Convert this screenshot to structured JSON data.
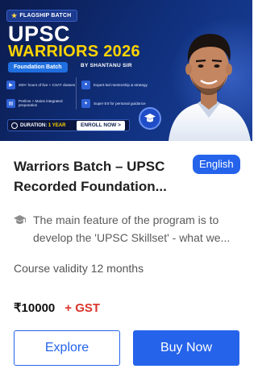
{
  "banner": {
    "tag": "FLAGSHIP BATCH",
    "title_line1": "UPSC",
    "title_line2": "WARRIORS 2026",
    "foundation_label": "Foundation Batch",
    "by_line": "BY SHANTANU SIR",
    "features": [
      "200+ hours of live + CSAT classes",
      "Expert-led mentorship & strategy",
      "Prelims + Mains integrated preparation",
      "Super EII for personal guidance"
    ],
    "duration_prefix": "DURATION:",
    "duration_value": "1 YEAR",
    "enroll_label": "ENROLL NOW >"
  },
  "course": {
    "title": "Warriors Batch – UPSC Recorded Foundation...",
    "language": "English",
    "description": "The main feature of the program is to develop the 'UPSC Skillset' - what we...",
    "validity": "Course validity 12 months",
    "price": "₹10000",
    "gst": "+ GST"
  },
  "actions": {
    "explore": "Explore",
    "buy_now": "Buy Now"
  },
  "colors": {
    "primary": "#2563eb",
    "gst_red": "#d9342b",
    "banner_navy": "#0b1b4d",
    "banner_yellow": "#ffd400"
  },
  "icons": {
    "description": "graduation-cap-icon",
    "banner_badge": "graduation-cap-icon"
  }
}
